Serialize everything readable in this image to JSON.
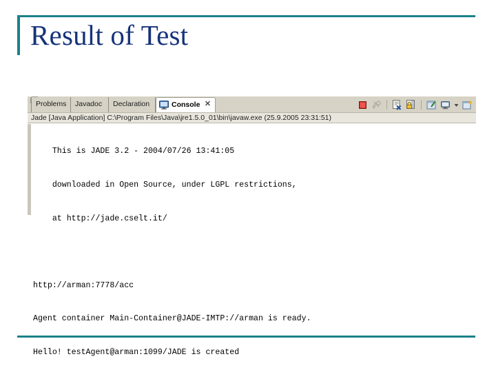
{
  "slide": {
    "title": "Result of Test",
    "accent_color": "#1b8189",
    "title_color": "#16337a",
    "background_color": "#ffffff"
  },
  "console_window": {
    "tabs": [
      {
        "label": "Problems",
        "active": false,
        "icon": ""
      },
      {
        "label": "Javadoc",
        "active": false,
        "icon": ""
      },
      {
        "label": "Declaration",
        "active": false,
        "icon": ""
      },
      {
        "label": "Console",
        "active": true,
        "icon": "console-monitor-icon",
        "close": "✕"
      }
    ],
    "toolbar": [
      {
        "name": "terminate-button",
        "title": "Terminate"
      },
      {
        "name": "remove-all-terminated-button",
        "title": "Remove All Terminated Launches"
      },
      {
        "name": "clear-console-button",
        "title": "Clear Console"
      },
      {
        "name": "scroll-lock-button",
        "title": "Scroll Lock"
      },
      {
        "name": "pin-console-button",
        "title": "Pin Console"
      },
      {
        "name": "display-selected-console-button",
        "title": "Display Selected Console"
      },
      {
        "name": "console-dropdown-arrow",
        "title": "Open Console Menu"
      },
      {
        "name": "open-console-button",
        "title": "Open Console"
      }
    ],
    "launch_config": "Jade [Java Application] C:\\Program Files\\Java\\jre1.5.0_01\\bin\\javaw.exe (25.9.2005 23:31:51)",
    "output_lines": [
      "    This is JADE 3.2 - 2004/07/26 13:41:05",
      "    downloaded in Open Source, under LGPL restrictions,",
      "    at http://jade.cselt.it/",
      "",
      "http://arman:7778/acc",
      "Agent container Main-Container@JADE-IMTP://arman is ready.",
      "Hello! testAgent@arman:1099/JADE is created"
    ]
  }
}
